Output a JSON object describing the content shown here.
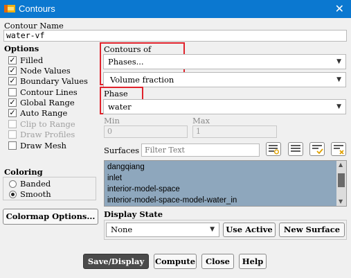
{
  "window": {
    "title": "Contours",
    "close_glyph": "✕"
  },
  "contour_name": {
    "label": "Contour Name",
    "value": "water-vf"
  },
  "options": {
    "title": "Options",
    "items": [
      {
        "label": "Filled",
        "checked": true,
        "enabled": true
      },
      {
        "label": "Node Values",
        "checked": true,
        "enabled": true
      },
      {
        "label": "Boundary Values",
        "checked": true,
        "enabled": true
      },
      {
        "label": "Contour Lines",
        "checked": false,
        "enabled": true
      },
      {
        "label": "Global Range",
        "checked": true,
        "enabled": true
      },
      {
        "label": "Auto Range",
        "checked": true,
        "enabled": true
      },
      {
        "label": "Clip to Range",
        "checked": false,
        "enabled": false
      },
      {
        "label": "Draw Profiles",
        "checked": false,
        "enabled": false
      },
      {
        "label": "Draw Mesh",
        "checked": false,
        "enabled": true
      }
    ]
  },
  "contours_of": {
    "label": "Contours of",
    "category": "Phases...",
    "variable": "Volume fraction"
  },
  "phase": {
    "label": "Phase",
    "value": "water"
  },
  "range": {
    "min_label": "Min",
    "min_value": "0",
    "max_label": "Max",
    "max_value": "1"
  },
  "surfaces": {
    "label": "Surfaces",
    "filter_placeholder": "Filter Text",
    "items": [
      "dangqiang",
      "inlet",
      "interior-model-space",
      "interior-model-space-model-water_in"
    ]
  },
  "coloring": {
    "title": "Coloring",
    "options": [
      {
        "label": "Banded",
        "selected": false
      },
      {
        "label": "Smooth",
        "selected": true
      }
    ]
  },
  "colormap_button": "Colormap Options...",
  "display_state": {
    "label": "Display State",
    "value": "None",
    "use_active": "Use Active",
    "new_surface": "New Surface"
  },
  "footer": {
    "save_display": "Save/Display",
    "compute": "Compute",
    "close": "Close",
    "help": "Help"
  },
  "colors": {
    "titlebar": "#0b78d0",
    "highlight_box": "#e0222b",
    "list_bg": "#8ea7bd"
  }
}
